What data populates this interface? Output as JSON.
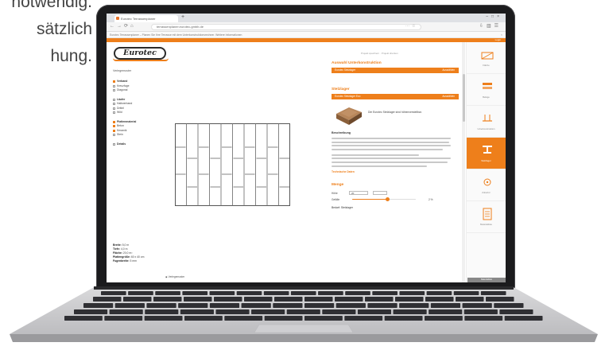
{
  "background_text": [
    "notwendig.",
    "sätzlich",
    "hung."
  ],
  "browser": {
    "tab_title": "Eurotec Terrassenplaner",
    "url": "terrassenplaner.eurotec-gmbh.de",
    "infobar": "Eurotec Terrassenplaner – Planen Sie Ihre Terrasse mit dem Unterkonstruktionsrechner. Weitere Informationen"
  },
  "site": {
    "brand": "Eurotec",
    "login_label": "Login",
    "top_link": "Projekt speichern · Projekt drucken",
    "left_panel": {
      "heading": "Verlegemuster",
      "groups": [
        [
          {
            "label": "Verband",
            "on": true,
            "bold": true
          },
          {
            "label": "Kreuzfuge",
            "on": false
          },
          {
            "label": "Diagonal",
            "on": false
          }
        ],
        [
          {
            "label": "Läufer",
            "on": false,
            "bold": true
          },
          {
            "label": "Halbverband",
            "on": false
          },
          {
            "label": "Drittel",
            "on": false
          },
          {
            "label": "Wild",
            "on": false
          }
        ],
        [
          {
            "label": "Plattenmaterial",
            "on": true,
            "bold": true
          },
          {
            "label": "Beton",
            "on": true
          },
          {
            "label": "Keramik",
            "on": true
          },
          {
            "label": "Stein",
            "on": false
          }
        ],
        [
          {
            "label": "Details",
            "on": false,
            "bold": true
          }
        ]
      ]
    },
    "specs": [
      {
        "key": "Breite:",
        "value": "5,0 m"
      },
      {
        "key": "Tiefe:",
        "value": "4,0 m"
      },
      {
        "key": "Fläche:",
        "value": "20,0 m²"
      },
      {
        "key": "Plattengröße:",
        "value": "60 x 40 cm"
      },
      {
        "key": "Fugenbreite:",
        "value": "5 mm"
      }
    ],
    "pattern_link": "Verlegemuster",
    "right_panel": {
      "section1_title": "Auswahl Unterkonstruktion",
      "section1_bar": "Eurotec Stelzlager",
      "section1_more": "Auswählen",
      "section2_title": "Stelzlager",
      "section2_bar": "Eurotec Stelzlager Eco",
      "section2_more": "Auswählen",
      "product_text": "Die Eurotec Stelzlager sind höhenverstellbar.",
      "description_title": "Beschreibung",
      "description_link": "Technische Daten",
      "calc_title": "Menge",
      "calc_label1": "Höhe",
      "calc_value1": "20",
      "calc_label2": "Gefälle",
      "slider_value": "2 %",
      "slider_fraction": 0.55,
      "result": "Bedarf: Stelzlager"
    },
    "side_nav": [
      {
        "label": "Fläche",
        "icon": "area-icon",
        "active": false
      },
      {
        "label": "Beläge",
        "icon": "decking-icon",
        "active": false
      },
      {
        "label": "Unterkonstruktion",
        "icon": "substructure-icon",
        "active": false
      },
      {
        "label": "Stelzlager",
        "icon": "pedestal-icon",
        "active": true
      },
      {
        "label": "Zubehör",
        "icon": "accessories-icon",
        "active": false
      },
      {
        "label": "Materialliste",
        "icon": "list-icon",
        "active": false
      }
    ],
    "side_footer": "Materialliste"
  },
  "colors": {
    "accent": "#ee7f1b",
    "bezel": "#1b1b1d"
  }
}
